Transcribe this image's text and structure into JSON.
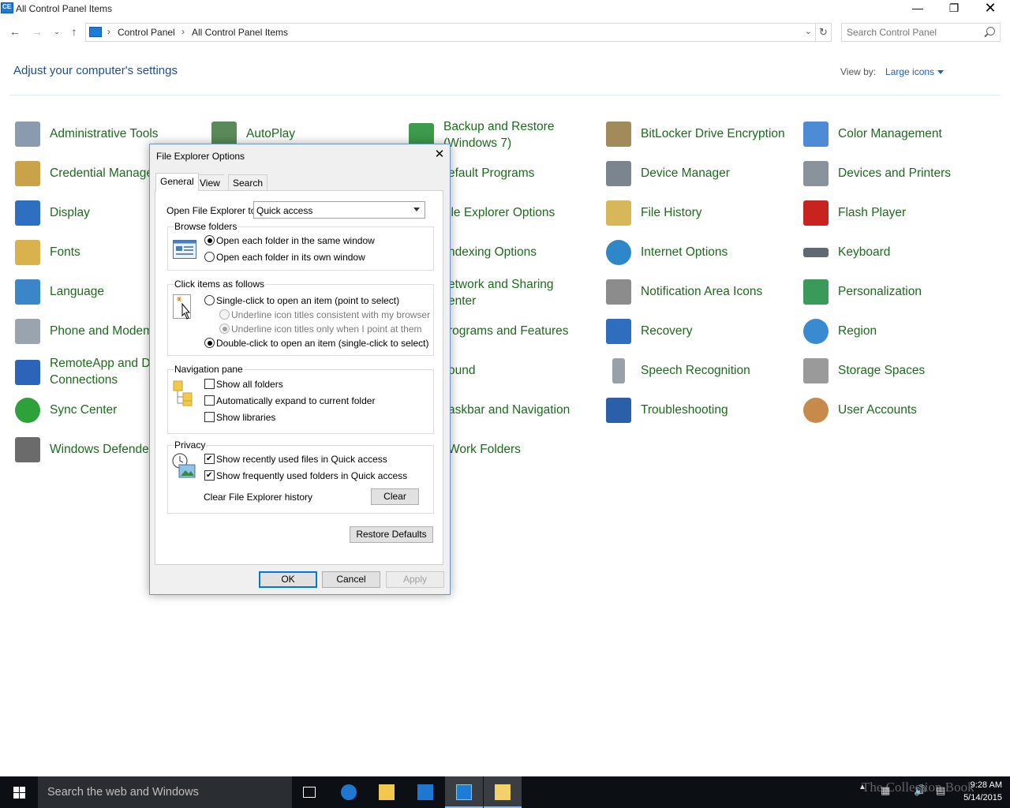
{
  "window": {
    "title": "All Control Panel Items"
  },
  "address": {
    "crumbs": [
      "Control Panel",
      "All Control Panel Items"
    ],
    "search_placeholder": "Search Control Panel"
  },
  "header": {
    "heading": "Adjust your computer's settings",
    "view_by_label": "View by:",
    "view_by_value": "Large icons"
  },
  "items": {
    "c0": [
      "Administrative Tools",
      "Credential Manager",
      "Display",
      "Fonts",
      "Language",
      "Phone and Modem",
      "RemoteApp and Desktop Connections",
      "Sync Center",
      "Windows Defender"
    ],
    "c0_visible": [
      "Administrative Tools",
      "Credential Manage",
      "Display",
      "Fonts",
      "Language",
      "Phone and Modem",
      "RemoteApp and D",
      "Connections",
      "Sync Center",
      "Windows Defende"
    ],
    "c1": [
      "AutoPlay"
    ],
    "c2_visible": [
      "Backup and Restore",
      "(Windows 7)",
      "efault Programs",
      "ile Explorer Options",
      "ndexing Options",
      "etwork and Sharing",
      "enter",
      "rograms and Features",
      "ound",
      "askbar and Navigation",
      "Work Folders"
    ],
    "c3": [
      "BitLocker Drive Encryption",
      "Device Manager",
      "File History",
      "Internet Options",
      "Notification Area Icons",
      "Recovery",
      "Speech Recognition",
      "Troubleshooting"
    ],
    "c4": [
      "Color Management",
      "Devices and Printers",
      "Flash Player",
      "Keyboard",
      "Personalization",
      "Region",
      "Storage Spaces",
      "User Accounts"
    ]
  },
  "dialog": {
    "title": "File Explorer Options",
    "tabs": [
      "General",
      "View",
      "Search"
    ],
    "open_to_label": "Open File Explorer to:",
    "open_to_value": "Quick access",
    "browse_title": "Browse folders",
    "browse_same": "Open each folder in the same window",
    "browse_own": "Open each folder in its own window",
    "click_title": "Click items as follows",
    "single_click": "Single-click to open an item (point to select)",
    "underline_browser": "Underline icon titles consistent with my browser",
    "underline_point": "Underline icon titles only when I point at them",
    "double_click": "Double-click to open an item (single-click to select)",
    "nav_title": "Navigation pane",
    "show_all": "Show all folders",
    "auto_expand": "Automatically expand to current folder",
    "show_libs": "Show libraries",
    "privacy_title": "Privacy",
    "recent_files": "Show recently used files in Quick access",
    "freq_folders": "Show frequently used folders in Quick access",
    "clear_history": "Clear File Explorer history",
    "clear": "Clear",
    "restore": "Restore Defaults",
    "ok": "OK",
    "cancel": "Cancel",
    "apply": "Apply"
  },
  "taskbar": {
    "search": "Search the web and Windows",
    "time": "9:28 AM",
    "date": "5/14/2015",
    "watermark": "The Collection Book"
  }
}
